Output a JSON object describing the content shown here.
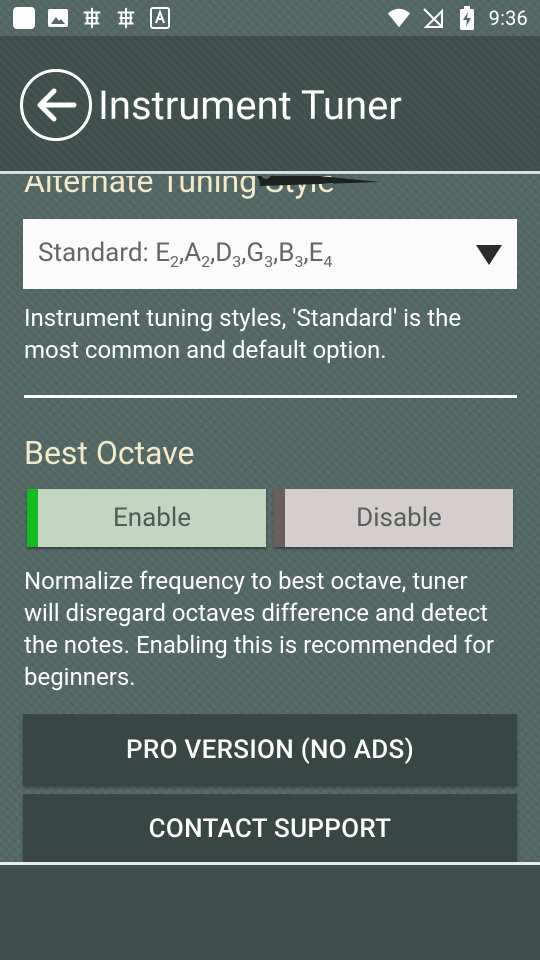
{
  "status_bar": {
    "time": "9:36",
    "icons": [
      "app-square-icon",
      "image-icon",
      "bug-icon",
      "bug-icon",
      "font-a-icon",
      "wifi-icon",
      "no-sim-icon",
      "battery-charging-icon"
    ]
  },
  "toolbar": {
    "title": "Instrument Tuner"
  },
  "tuning": {
    "heading": "Alternate Tuning Style",
    "selected": [
      {
        "note": "E",
        "octave": "2"
      },
      {
        "note": "A",
        "octave": "2"
      },
      {
        "note": "D",
        "octave": "3"
      },
      {
        "note": "G",
        "octave": "3"
      },
      {
        "note": "B",
        "octave": "3"
      },
      {
        "note": "E",
        "octave": "4"
      }
    ],
    "selected_prefix": "Standard: ",
    "description": "Instrument tuning styles, 'Standard' is the most common and default option."
  },
  "octave": {
    "heading": "Best Octave",
    "enable_label": "Enable",
    "disable_label": "Disable",
    "description": "Normalize frequency to best octave, tuner will disregard octaves difference and detect the notes. Enabling this is recommended for beginners."
  },
  "actions": {
    "pro_label": "PRO VERSION (NO ADS)",
    "contact_label": "CONTACT SUPPORT"
  },
  "colors": {
    "heading": "#f2eacb",
    "enable_accent": "#0fbe1b",
    "toolbar": "#3e4f4c"
  }
}
